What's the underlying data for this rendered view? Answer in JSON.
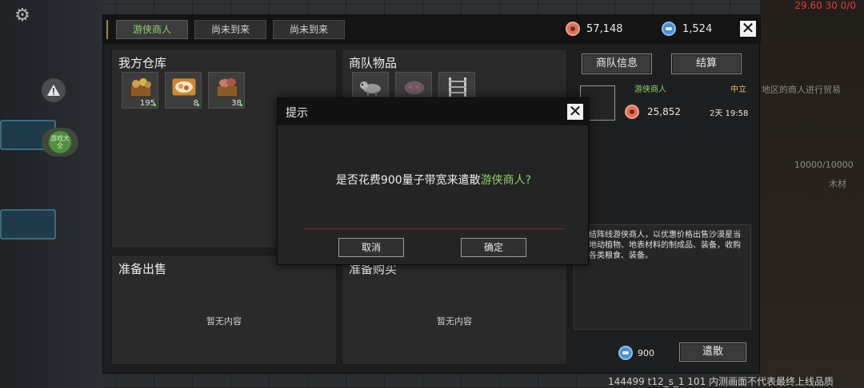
{
  "hud": {
    "top_right_readout": "29.60 30 0/0",
    "footer_text": "144499 t12_s_1 101 内测画面不代表最终上线品质",
    "right_bg_text_1": "地区的商人进行贸易",
    "right_bg_text_2": "10000/10000",
    "right_bg_text_3": "木材",
    "badge_text": "游戏大全"
  },
  "tabs": [
    {
      "label": "游侠商人",
      "active": true
    },
    {
      "label": "尚未到来",
      "active": false
    },
    {
      "label": "尚未到来",
      "active": false
    }
  ],
  "currency": {
    "coins": "57,148",
    "data": "1,524"
  },
  "warehouse": {
    "title": "我方仓库",
    "items": [
      {
        "icon": "crate-of-potatoes-icon",
        "qty": "195"
      },
      {
        "icon": "plate-of-food-icon",
        "qty": "8"
      },
      {
        "icon": "crate-of-meat-icon",
        "qty": "38"
      }
    ]
  },
  "caravan": {
    "title": "商队物品",
    "items": [
      {
        "icon": "raccoon-creature-icon"
      },
      {
        "icon": "hedgehog-creature-icon"
      },
      {
        "icon": "metal-ladder-icon"
      }
    ]
  },
  "sell": {
    "title": "准备出售",
    "empty": "暂无内容"
  },
  "buy": {
    "title": "准备购买",
    "empty": "暂无内容"
  },
  "info": {
    "tab_info": "商队信息",
    "tab_settle": "结算",
    "merchant_name": "游侠商人",
    "stance": "中立",
    "merchant_coins": "25,852",
    "time_left": "2天 19:58",
    "description": "结阵线游侠商人，以优惠价格出售沙漠星当地动植物、地表材料的制成品、装备，收购各类粮食、装备。",
    "dismiss_cost": "900",
    "dismiss_label": "遣散"
  },
  "dialog": {
    "title": "提示",
    "message_prefix": "是否花费900量子带宽来遣散",
    "message_highlight": "游侠商人",
    "message_suffix": "?",
    "cancel_label": "取消",
    "confirm_label": "确定"
  },
  "colors": {
    "highlight_green": "#8fd16a",
    "panel_bg": "#1e1f20",
    "alert_red": "#e03b3b"
  }
}
